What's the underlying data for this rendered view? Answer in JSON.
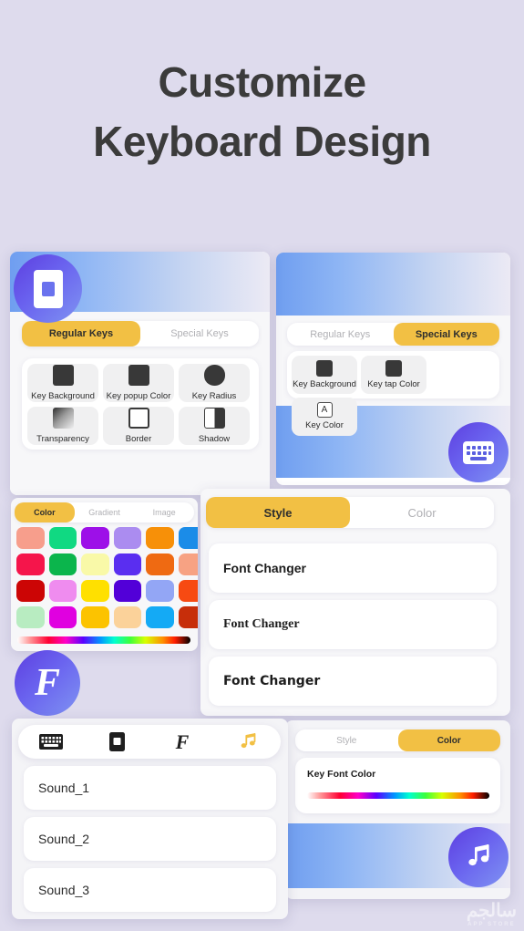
{
  "headline": {
    "line1": "Customize",
    "line2": "Keyboard Design"
  },
  "theme": {
    "background": "#dedbed",
    "accent_yellow": "#f2c044",
    "banner_blue_start": "#6f9ef0",
    "banner_blue_end": "#eceaf4",
    "fab_purple_start": "#5d3fe0",
    "fab_purple_end": "#7f93f2",
    "text_dark": "#3b3b3b"
  },
  "card_regular_keys": {
    "logo_icon": "keyboard-app-logo-icon",
    "tabs": [
      {
        "label": "Regular Keys",
        "active": true
      },
      {
        "label": "Special Keys",
        "active": false
      }
    ],
    "tiles": [
      {
        "label": "Key Background",
        "icon": "filled-square-icon",
        "style": "sq"
      },
      {
        "label": "Key popup Color",
        "icon": "filled-square-icon",
        "style": "sq"
      },
      {
        "label": "Key Radius",
        "icon": "rounded-square-icon",
        "style": "sq circle"
      },
      {
        "label": "Transparency",
        "icon": "gradient-square-icon",
        "style": "sq grad"
      },
      {
        "label": "Border",
        "icon": "outlined-square-icon",
        "style": "sq outline"
      },
      {
        "label": "Shadow",
        "icon": "half-filled-square-icon",
        "style": "sq half"
      }
    ]
  },
  "card_special_keys": {
    "tabs": [
      {
        "label": "Regular Keys",
        "active": false
      },
      {
        "label": "Special Keys",
        "active": true
      }
    ],
    "tiles": [
      {
        "label": "Key Background",
        "icon": "filled-square-icon",
        "style": "sq"
      },
      {
        "label": "Key tap Color",
        "icon": "filled-square-icon",
        "style": "sq"
      },
      {
        "label": "Key Color",
        "icon": "letter-a-box-icon",
        "style": "sq letter",
        "glyph": "A"
      }
    ],
    "fab_icon": "keyboard-icon"
  },
  "card_color_picker": {
    "tabs": [
      {
        "label": "Color",
        "active": true
      },
      {
        "label": "Gradient",
        "active": false
      },
      {
        "label": "Image",
        "active": false
      }
    ],
    "swatches": [
      "#f79e8c",
      "#10d982",
      "#9d10e8",
      "#ab8cf0",
      "#f79008",
      "#1b8ce8",
      "#f5154b",
      "#0bb54c",
      "#f9f9a8",
      "#5a2ef0",
      "#ef6a12",
      "#f7a283",
      "#cc0505",
      "#ef8cef",
      "#ffe000",
      "#5200d8",
      "#93a6f5",
      "#f74a12",
      "#b8ecc1",
      "#e000e0",
      "#fcc300",
      "#fbd29a",
      "#14aaf5",
      "#c72e0a"
    ],
    "slider_icon": "rainbow-gradient-slider",
    "logo_icon": "font-changer-logo-icon"
  },
  "card_font_style": {
    "tabs": [
      {
        "label": "Style",
        "active": true
      },
      {
        "label": "Color",
        "active": false
      }
    ],
    "rows": [
      {
        "label": "Font Changer",
        "font": "f-sans"
      },
      {
        "label": "Font Changer",
        "font": "f-serif"
      },
      {
        "label": "Font Changer",
        "font": "f-sans2"
      }
    ]
  },
  "card_sounds": {
    "icon_tabs": [
      {
        "icon": "keyboard-icon",
        "active": false
      },
      {
        "icon": "key-square-icon",
        "active": false
      },
      {
        "icon": "font-f-icon",
        "active": false
      },
      {
        "icon": "music-note-icon",
        "active": true
      }
    ],
    "rows": [
      {
        "label": "Sound_1"
      },
      {
        "label": "Sound_2"
      },
      {
        "label": "Sound_3"
      }
    ]
  },
  "card_key_font_color": {
    "tabs": [
      {
        "label": "Style",
        "active": false
      },
      {
        "label": "Color",
        "active": true
      }
    ],
    "field_label": "Key Font Color",
    "slider_icon": "rainbow-gradient-slider",
    "fab_icon": "music-note-icon"
  },
  "watermark": {
    "text": "سالجم",
    "sub": "APP STORE"
  }
}
